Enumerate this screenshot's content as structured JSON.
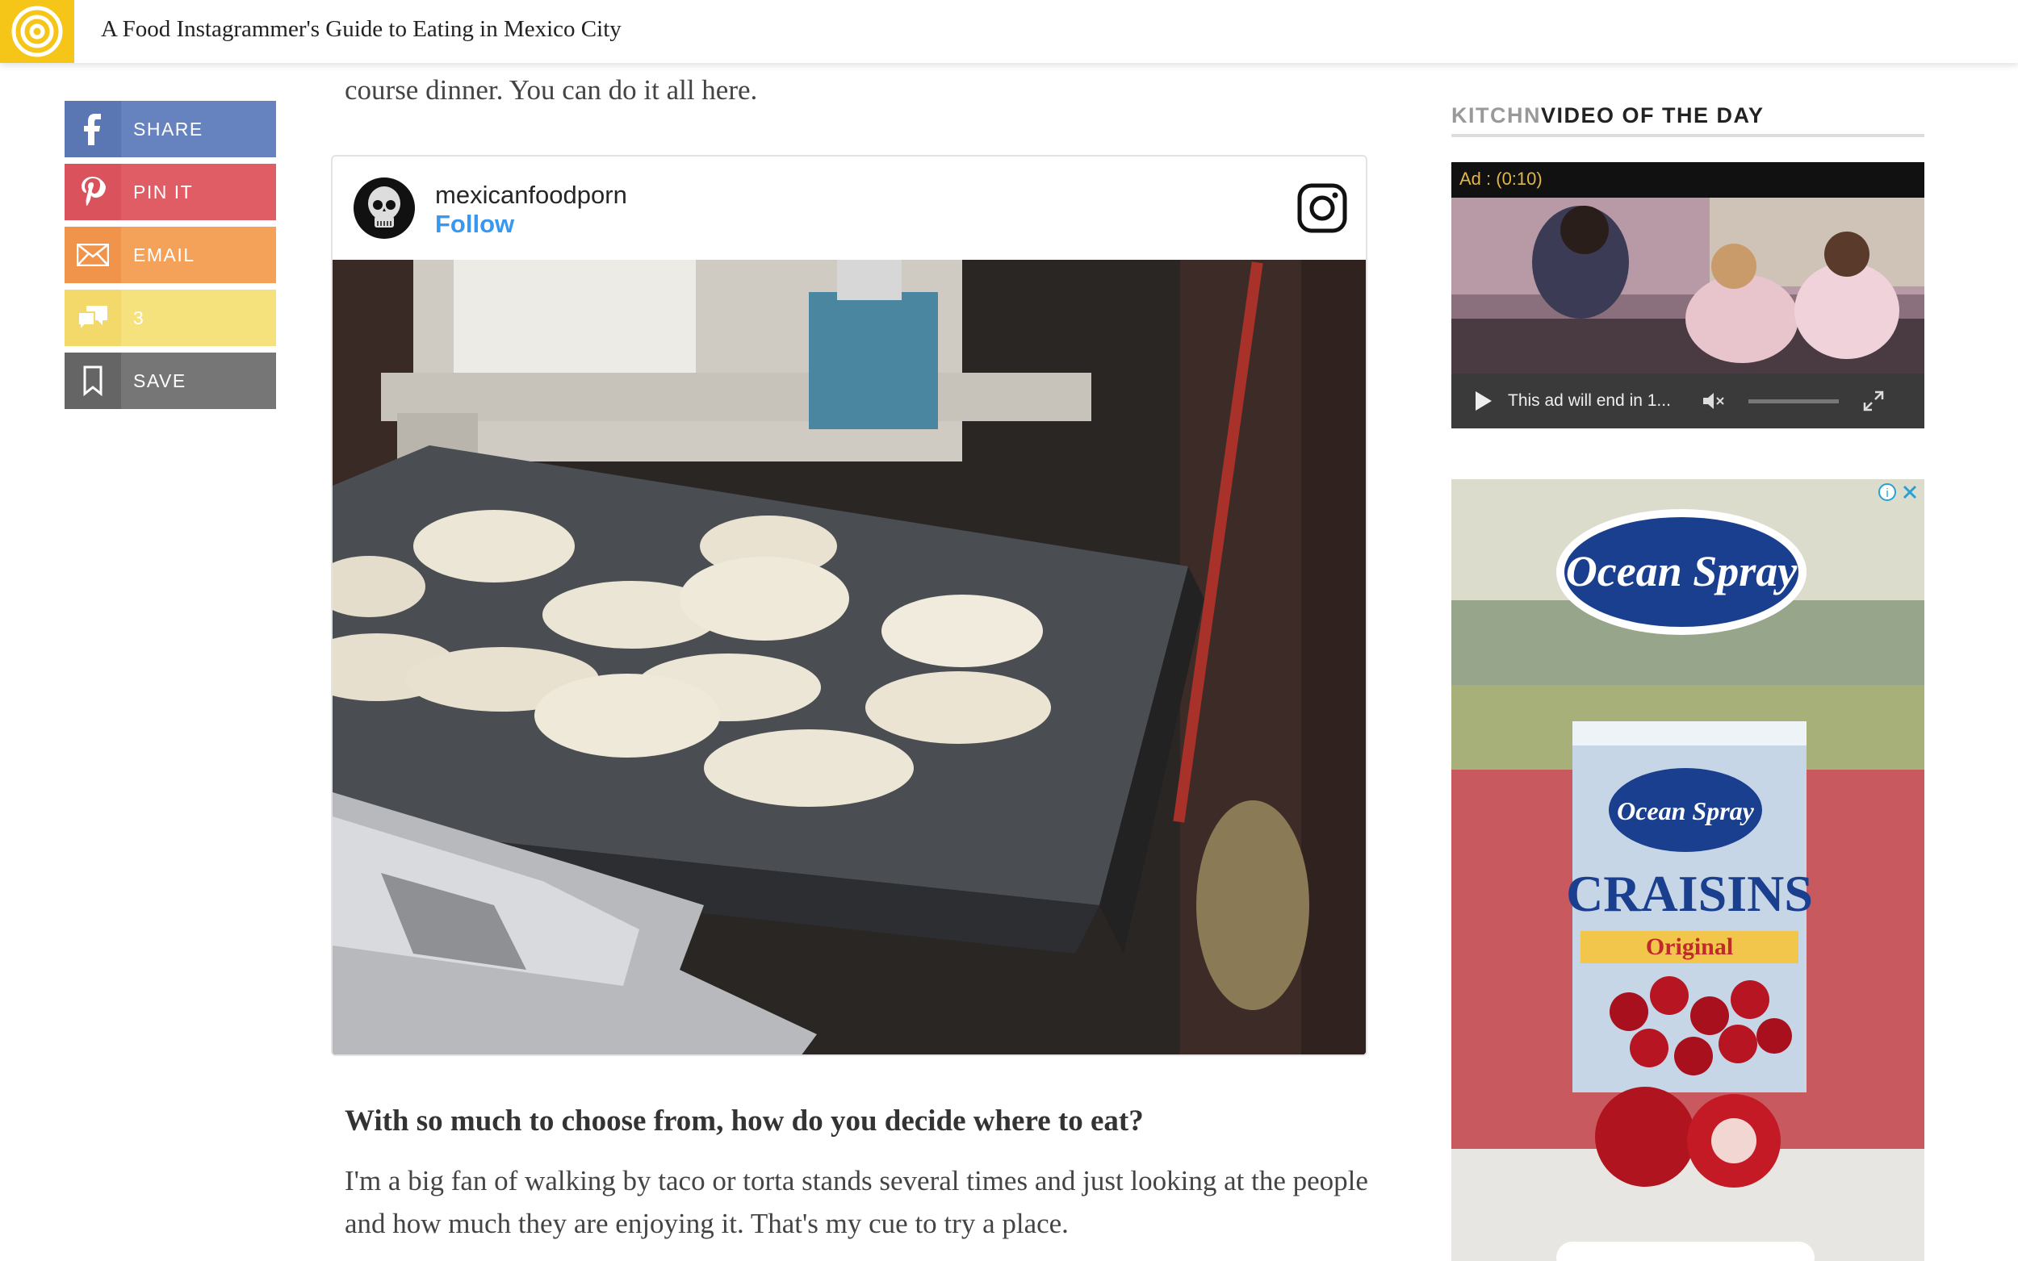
{
  "header": {
    "title": "A Food Instagrammer's Guide to Eating in Mexico City",
    "logo_icon": "target-logo-icon"
  },
  "share": {
    "facebook_label": "SHARE",
    "pinterest_label": "PIN IT",
    "email_label": "EMAIL",
    "comments_count": "3",
    "save_label": "SAVE"
  },
  "article": {
    "intro_tail": "course dinner. You can do it all here.",
    "instagram": {
      "username": "mexicanfoodporn",
      "follow_label": "Follow",
      "photo_alt": "Tortillas cooking on a comal"
    },
    "subheading": "With so much to choose from, how do you decide where to eat?",
    "paragraph": "I'm a big fan of walking by taco or torta stands several times and just looking at the people and how much they are enjoying it. That's my cue to try a place."
  },
  "sidebar": {
    "video_brand": "KITCHN",
    "video_title": "VIDEO OF THE DAY",
    "ad_label": "Ad : (0:10)",
    "ad_end_text": "This ad will end in 1..."
  },
  "ad": {
    "brand": "Ocean Spray",
    "product": "CRAISINS",
    "variant": "Original"
  },
  "colors": {
    "logo_yellow": "#f5c518",
    "facebook": "#6683bf",
    "pinterest": "#e05d66",
    "email": "#f4a15a",
    "comments": "#f6e27c",
    "save": "#767676",
    "instagram_blue": "#3897f0"
  }
}
